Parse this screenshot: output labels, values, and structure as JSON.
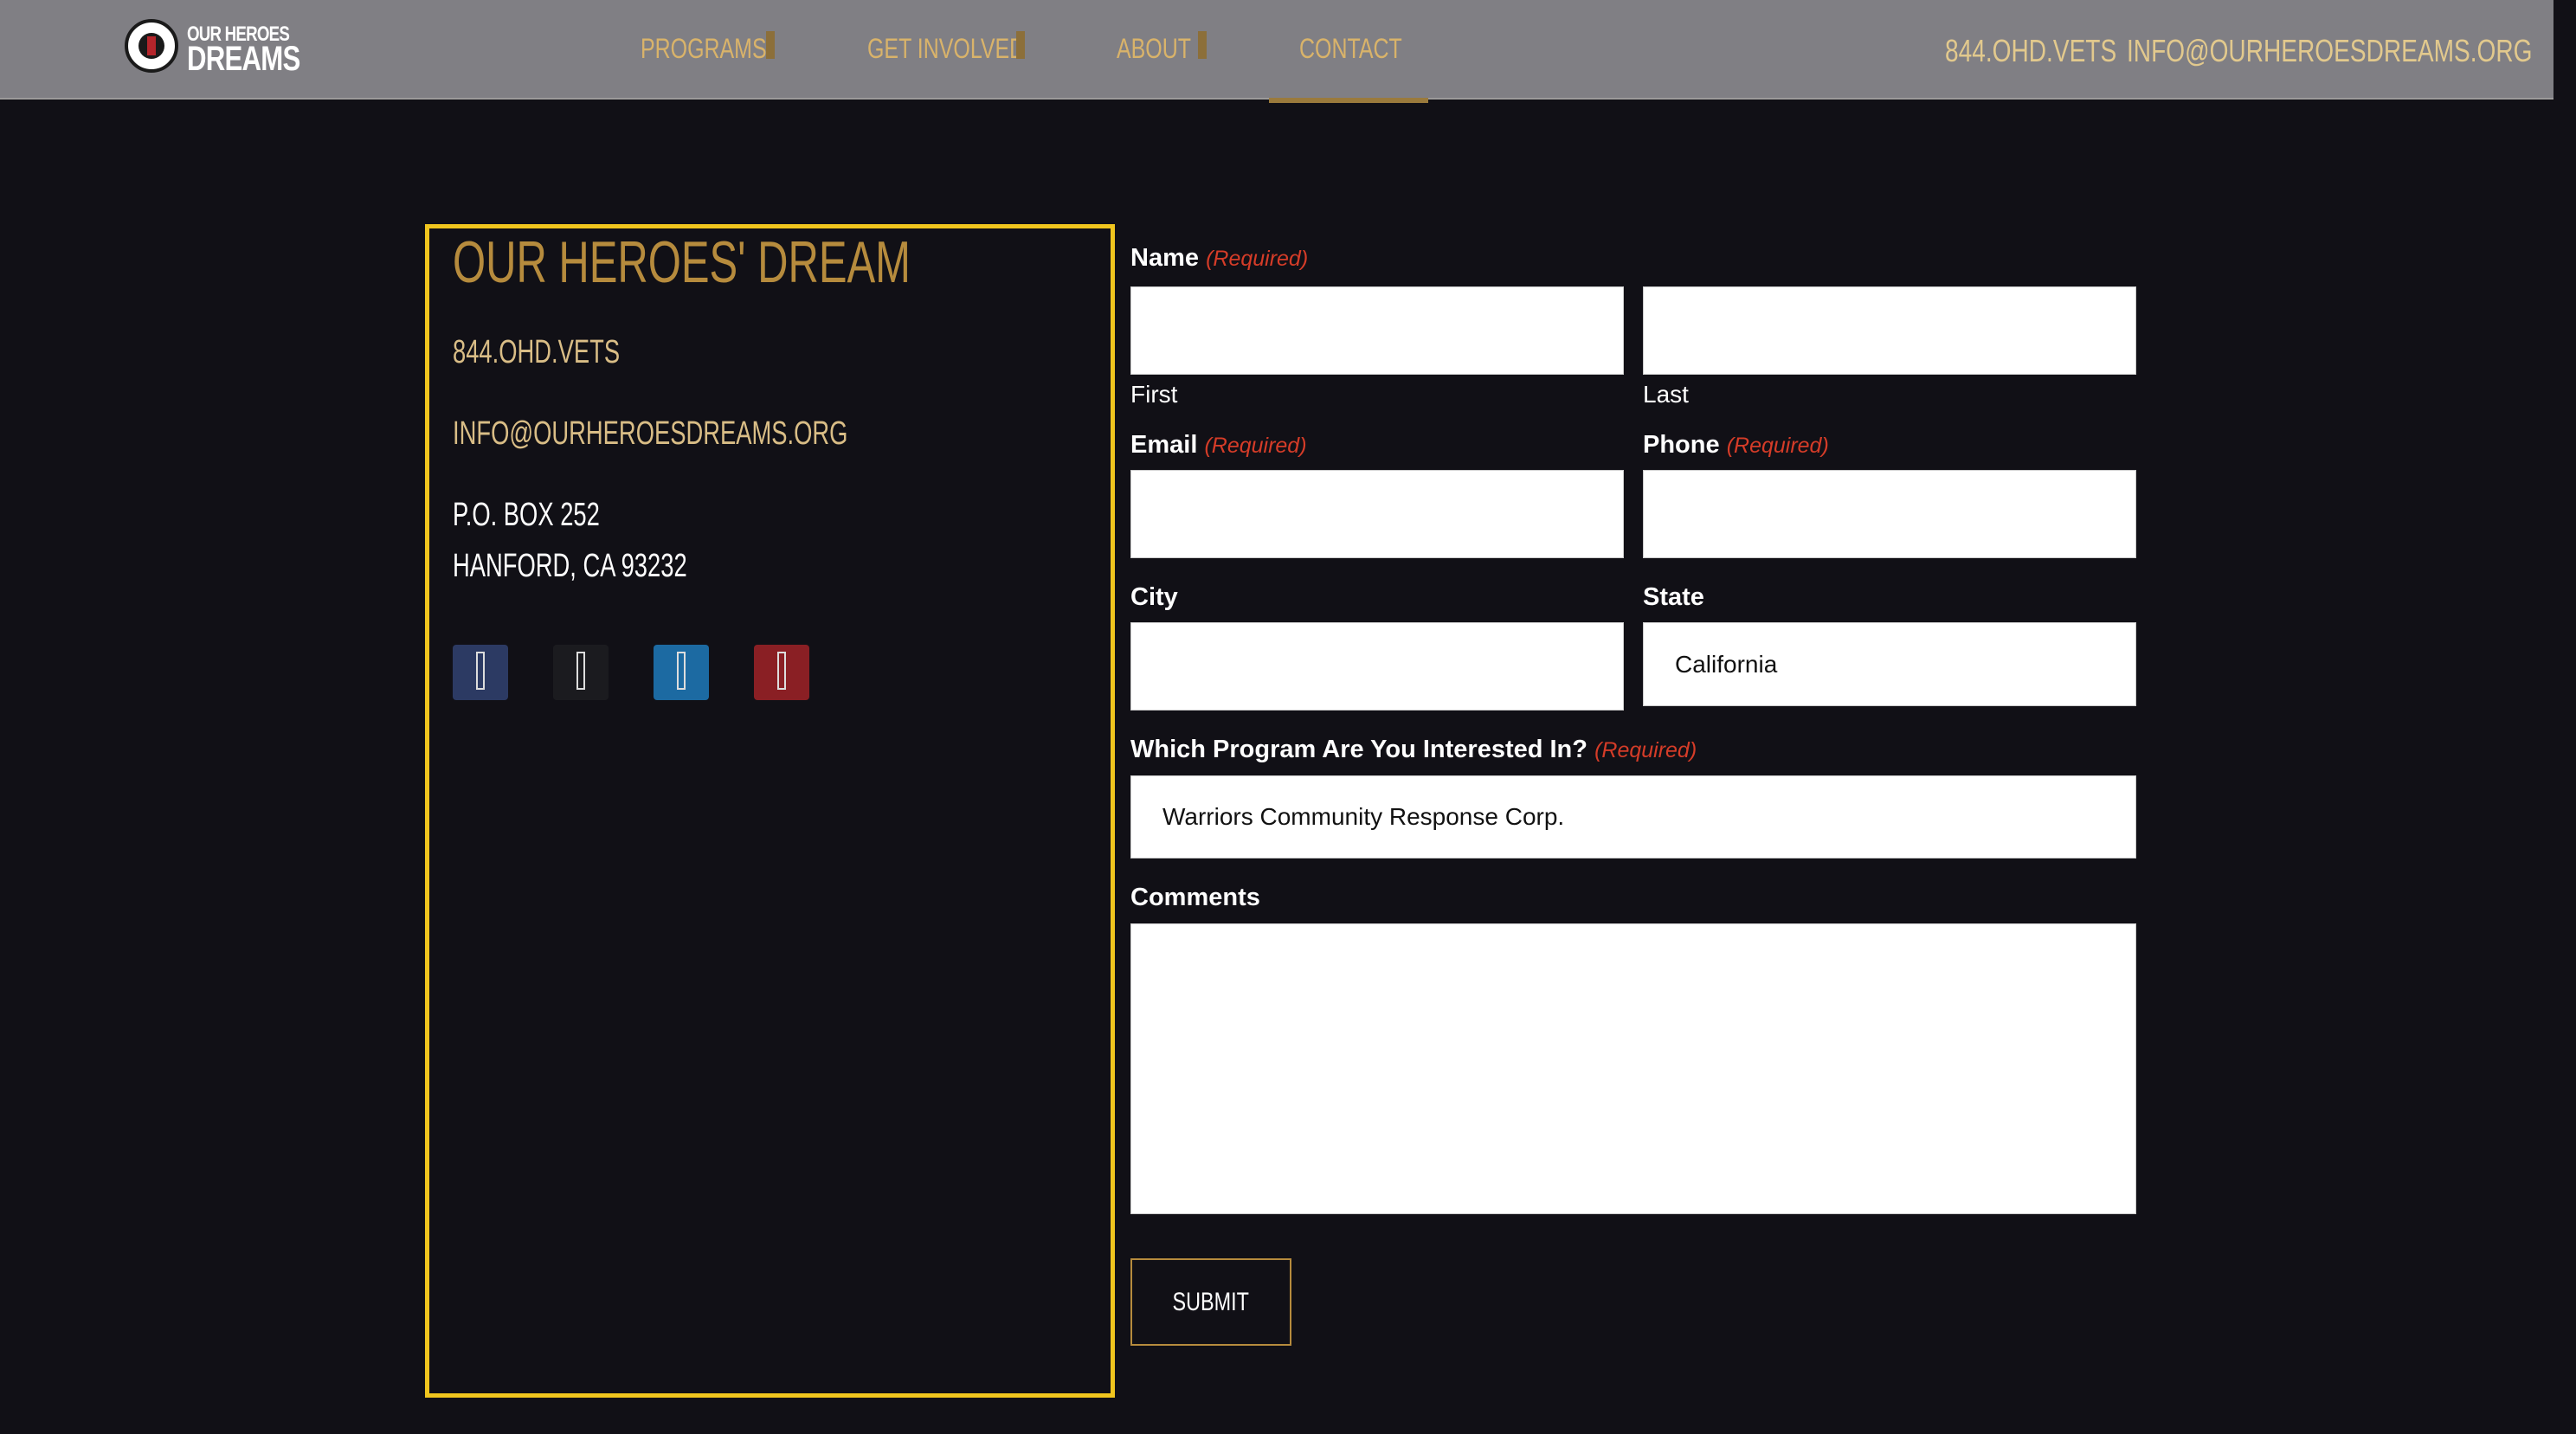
{
  "header": {
    "logo_line1": "OUR HEROES",
    "logo_line2": "DREAMS",
    "nav": [
      {
        "label": "PROGRAMS"
      },
      {
        "label": "GET INVOLVED"
      },
      {
        "label": "ABOUT"
      },
      {
        "label": "CONTACT",
        "active": true
      }
    ],
    "phone": "844.OHD.VETS",
    "email": "INFO@OURHEROESDREAMS.ORG"
  },
  "info": {
    "title": "OUR HEROES' DREAM",
    "phone": "844.OHD.VETS",
    "email": "INFO@OURHEROESDREAMS.ORG",
    "address_line1": "P.O. BOX 252",
    "address_line2": "HANFORD, CA 93232",
    "social": [
      {
        "icon": "facebook-icon",
        "color": "#2c3a63"
      },
      {
        "icon": "x-icon",
        "color": "#1b1b1f"
      },
      {
        "icon": "linkedin-icon",
        "color": "#1c6aa2"
      },
      {
        "icon": "youtube-icon",
        "color": "#8a1f24"
      }
    ]
  },
  "form": {
    "required_text": "(Required)",
    "name_label": "Name",
    "first_sub": "First",
    "last_sub": "Last",
    "email_label": "Email",
    "phone_label": "Phone",
    "city_label": "City",
    "state_label": "State",
    "state_value": "California",
    "program_label": "Which Program Are You Interested In?",
    "program_value": "Warriors Community Response Corp.",
    "comments_label": "Comments",
    "submit_label": "SUBMIT"
  },
  "colors": {
    "background": "#111016",
    "header": "#807f84",
    "accent_gold": "#b68b3d",
    "panel_border": "#f0c51e",
    "required_red": "#d53c28"
  }
}
